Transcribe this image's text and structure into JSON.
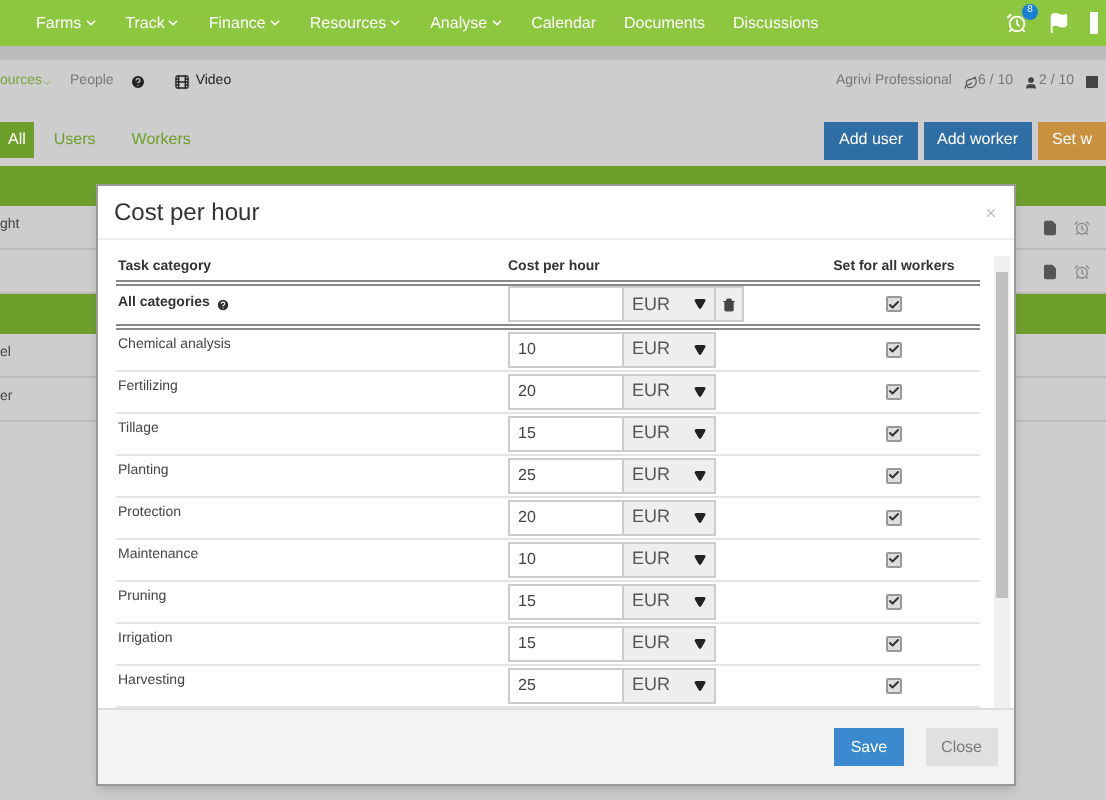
{
  "navbar": {
    "items": [
      {
        "label": "Farms",
        "dropdown": true
      },
      {
        "label": "Track",
        "dropdown": true
      },
      {
        "label": "Finance",
        "dropdown": true
      },
      {
        "label": "Resources",
        "dropdown": true
      },
      {
        "label": "Analyse",
        "dropdown": true
      },
      {
        "label": "Calendar",
        "dropdown": false
      },
      {
        "label": "Documents",
        "dropdown": false
      },
      {
        "label": "Discussions",
        "dropdown": false
      }
    ],
    "alarm_badge": "8"
  },
  "subheader": {
    "breadcrumb": "ources",
    "page": "People",
    "video": "Video",
    "plan": "Agrivi Professional",
    "fields_count": "6 / 10",
    "users_count": "2 / 10"
  },
  "filter_tabs": [
    {
      "label": "All",
      "selected": true
    },
    {
      "label": "Users",
      "selected": false
    },
    {
      "label": "Workers",
      "selected": false
    }
  ],
  "action_buttons": [
    {
      "label": "Add user",
      "kind": "primary"
    },
    {
      "label": "Add worker",
      "kind": "primary"
    },
    {
      "label": "Set w",
      "kind": "warning"
    }
  ],
  "background_list": [
    {
      "kind": "group"
    },
    {
      "kind": "row",
      "label": "ght",
      "actions": true
    },
    {
      "kind": "row",
      "actions": true
    },
    {
      "kind": "group"
    },
    {
      "kind": "row",
      "label": "el",
      "actions": false
    },
    {
      "kind": "row",
      "label": "er",
      "actions": false
    }
  ],
  "modal": {
    "title": "Cost per hour",
    "columns": [
      "Task category",
      "Cost per hour",
      "Set for all workers"
    ],
    "all_row": {
      "label": "All categories",
      "currency": "EUR",
      "checked": true
    },
    "rows": [
      {
        "category": "Chemical analysis",
        "value": "10",
        "currency": "EUR",
        "checked": true
      },
      {
        "category": "Fertilizing",
        "value": "20",
        "currency": "EUR",
        "checked": true
      },
      {
        "category": "Tillage",
        "value": "15",
        "currency": "EUR",
        "checked": true
      },
      {
        "category": "Planting",
        "value": "25",
        "currency": "EUR",
        "checked": true
      },
      {
        "category": "Protection",
        "value": "20",
        "currency": "EUR",
        "checked": true
      },
      {
        "category": "Maintenance",
        "value": "10",
        "currency": "EUR",
        "checked": true
      },
      {
        "category": "Pruning",
        "value": "15",
        "currency": "EUR",
        "checked": true
      },
      {
        "category": "Irrigation",
        "value": "15",
        "currency": "EUR",
        "checked": true
      },
      {
        "category": "Harvesting",
        "value": "25",
        "currency": "EUR",
        "checked": true
      }
    ],
    "buttons": [
      {
        "label": "Save",
        "kind": "primary",
        "disabled": false
      },
      {
        "label": "Close",
        "kind": "default",
        "disabled": true
      }
    ]
  }
}
